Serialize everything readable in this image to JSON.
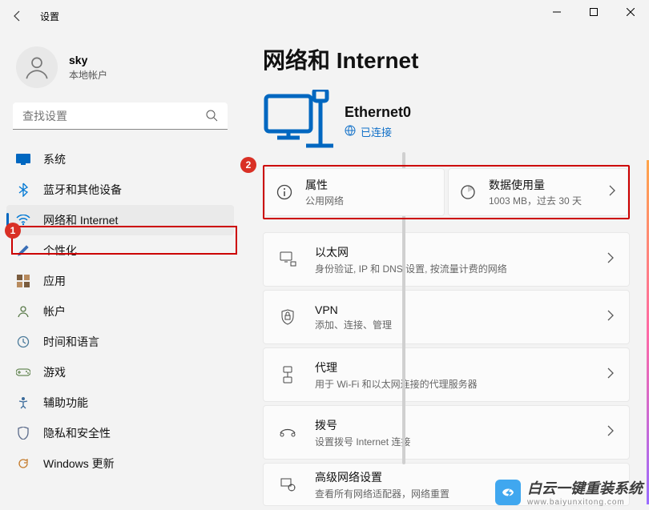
{
  "window": {
    "title": "设置"
  },
  "user": {
    "name": "sky",
    "sub": "本地帐户"
  },
  "search": {
    "placeholder": "查找设置"
  },
  "nav": [
    {
      "label": "系统"
    },
    {
      "label": "蓝牙和其他设备"
    },
    {
      "label": "网络和 Internet"
    },
    {
      "label": "个性化"
    },
    {
      "label": "应用"
    },
    {
      "label": "帐户"
    },
    {
      "label": "时间和语言"
    },
    {
      "label": "游戏"
    },
    {
      "label": "辅助功能"
    },
    {
      "label": "隐私和安全性"
    },
    {
      "label": "Windows 更新"
    }
  ],
  "page": {
    "title": "网络和 Internet"
  },
  "connection": {
    "name": "Ethernet0",
    "status": "已连接"
  },
  "cards": {
    "props": {
      "title": "属性",
      "sub": "公用网络"
    },
    "usage": {
      "title": "数据使用量",
      "sub": "1003 MB，过去 30 天"
    }
  },
  "list": [
    {
      "title": "以太网",
      "sub": "身份验证, IP 和 DNS 设置, 按流量计费的网络"
    },
    {
      "title": "VPN",
      "sub": "添加、连接、管理"
    },
    {
      "title": "代理",
      "sub": "用于 Wi-Fi 和以太网连接的代理服务器"
    },
    {
      "title": "拨号",
      "sub": "设置拨号 Internet 连接"
    },
    {
      "title": "高级网络设置",
      "sub": "查看所有网络适配器，网络重置"
    }
  ],
  "badges": {
    "one": "1",
    "two": "2"
  },
  "watermark": {
    "line1": "白云一键重装系统",
    "line2": "www.baiyunxitong.com"
  }
}
